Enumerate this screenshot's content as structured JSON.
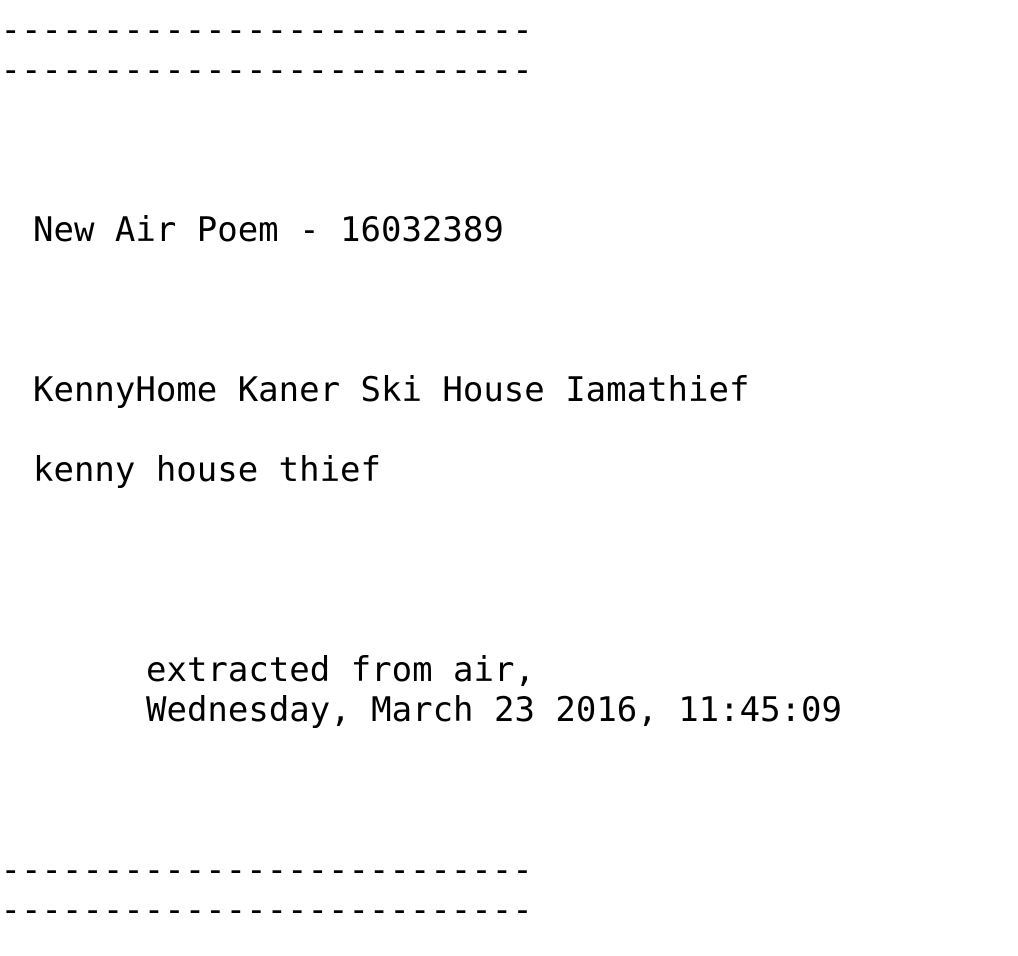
{
  "rules": {
    "top_1": "------------------------------",
    "top_2": "------------------------------",
    "bottom_1": "------------------------------",
    "bottom_2": "------------------------------"
  },
  "poem": {
    "title": "New Air Poem - 16032389",
    "line_1": "KennyHome Kaner Ski House Iamathief",
    "line_2": "kenny house thief"
  },
  "footer": {
    "extracted": "extracted from air,",
    "timestamp": "Wednesday, March 23 2016, 11:45:09"
  }
}
